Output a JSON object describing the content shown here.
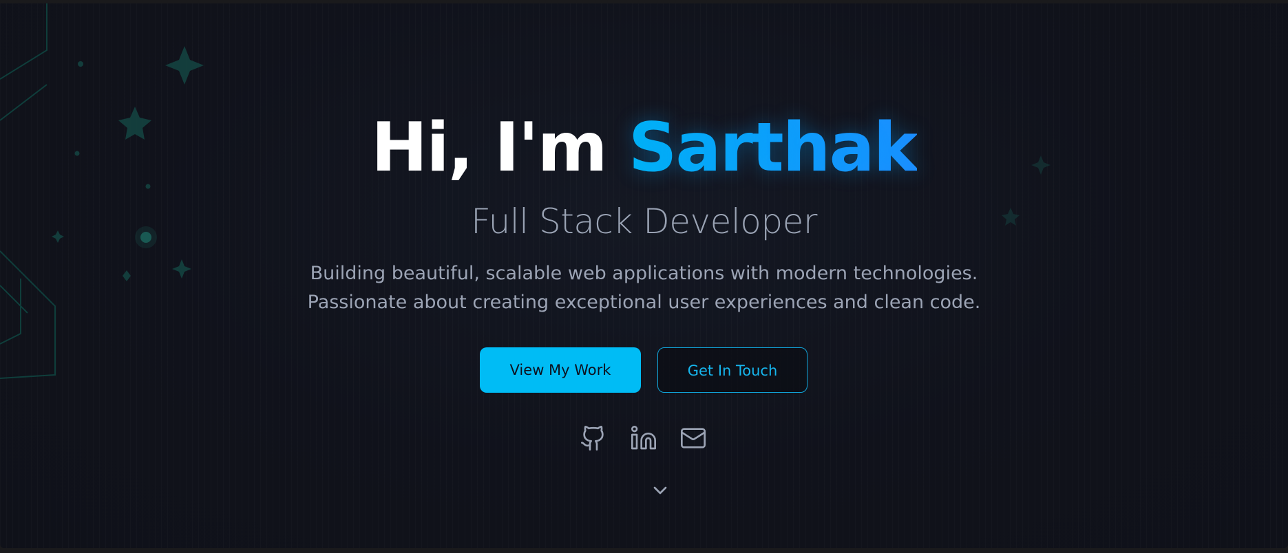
{
  "hero": {
    "greeting": "Hi, I'm",
    "name": "Sarthak",
    "role": "Full Stack Developer",
    "description_line1": "Building beautiful, scalable web applications with modern technologies.",
    "description_line2": "Passionate about creating exceptional user experiences and clean code."
  },
  "actions": {
    "primary_label": "View My Work",
    "secondary_label": "Get In Touch"
  },
  "socials": [
    {
      "icon": "github-icon"
    },
    {
      "icon": "linkedin-icon"
    },
    {
      "icon": "mail-icon"
    }
  ],
  "scroll": {
    "icon": "chevron-down-icon"
  },
  "colors": {
    "accent": "#00bcf5",
    "accent_gradient_end": "#1e8cff",
    "background": "#10121b",
    "muted_text": "#9ca4b5"
  }
}
